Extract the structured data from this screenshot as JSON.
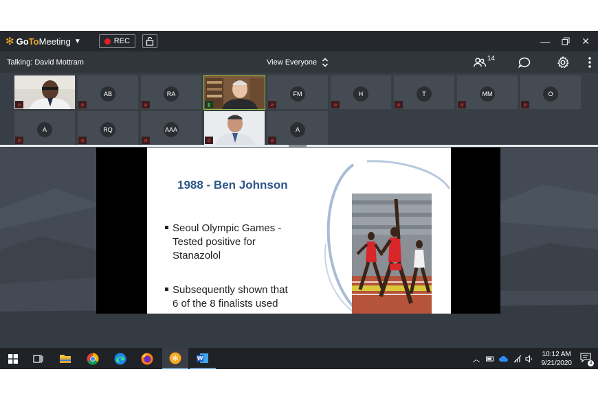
{
  "app": {
    "name_go": "Go",
    "name_to": "To",
    "name_meeting": "Meeting",
    "rec_label": "REC"
  },
  "talkbar": {
    "talking": "Talking: David Mottram",
    "view_label": "View Everyone",
    "participant_count": "14"
  },
  "participants": [
    {
      "initials": "",
      "has_video": true,
      "mic": "muted"
    },
    {
      "initials": "AB",
      "has_video": false,
      "mic": "muted"
    },
    {
      "initials": "RA",
      "has_video": false,
      "mic": "muted"
    },
    {
      "initials": "",
      "has_video": true,
      "mic": "active"
    },
    {
      "initials": "FM",
      "has_video": false,
      "mic": "muted"
    },
    {
      "initials": "H",
      "has_video": false,
      "mic": "muted"
    },
    {
      "initials": "T",
      "has_video": false,
      "mic": "muted"
    },
    {
      "initials": "MM",
      "has_video": false,
      "mic": "muted"
    },
    {
      "initials": "O",
      "has_video": false,
      "mic": "muted"
    },
    {
      "initials": "A",
      "has_video": false,
      "mic": "muted"
    },
    {
      "initials": "RQ",
      "has_video": false,
      "mic": "muted"
    },
    {
      "initials": "AAA",
      "has_video": false,
      "mic": "muted"
    },
    {
      "initials": "",
      "has_video": true,
      "mic": "muted"
    },
    {
      "initials": "A",
      "has_video": false,
      "mic": "muted"
    }
  ],
  "slide": {
    "title": "1988 - Ben Johnson",
    "bullet1_line1": "Seoul Olympic Games -",
    "bullet1_line2": "Tested positive for",
    "bullet1_line3": "Stanazolol",
    "bullet2_line1": "Subsequently shown that",
    "bullet2_line2": "6 of the 8 finalists used"
  },
  "taskbar": {
    "time": "10:12 AM",
    "date": "9/21/2020",
    "notification_count": "4"
  },
  "colors": {
    "titlebar": "#25292e",
    "accent_orange": "#f7a823",
    "rec_red": "#e41e26",
    "slide_title": "#2d5689"
  }
}
